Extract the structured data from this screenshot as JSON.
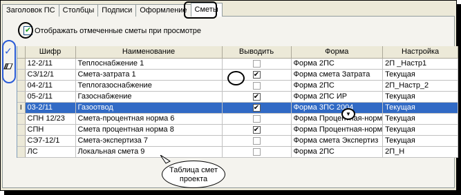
{
  "tabs": [
    {
      "label": "Заголовок ПС"
    },
    {
      "label": "Столбцы"
    },
    {
      "label": "Подписи"
    },
    {
      "label": "Оформление"
    },
    {
      "label": "Сметы"
    }
  ],
  "show_checkbox": {
    "label": "Отображать отмеченные сметы при просмотре",
    "checked": true
  },
  "grid": {
    "headers": [
      "Шифр",
      "Наименование",
      "Выводить",
      "Форма",
      "Настройка"
    ],
    "current_row_marker": "I",
    "rows": [
      {
        "code": "12-2/11",
        "name": "Теплоснабжение 1",
        "output": false,
        "form": "Форма 2ПС",
        "setting": "2П _Настр1"
      },
      {
        "code": "С3/12/1",
        "name": "Смета-затрата 1",
        "output": true,
        "form": "Форма смета Затрата",
        "setting": "Текущая"
      },
      {
        "code": "04-2/11",
        "name": "Теплогазоснабжение",
        "output": false,
        "form": "Форма 2ПС",
        "setting": "2П_Настр_2"
      },
      {
        "code": "05-2/11",
        "name": "Газоснабжение",
        "output": true,
        "form": "Форма 2ПС ИР",
        "setting": "Текущая"
      },
      {
        "code": "03-2/11",
        "name": "Газоотвод",
        "output": true,
        "form": "Форма 3ПС 2004",
        "setting": "Текущая",
        "selected": true
      },
      {
        "code": "СПН 12/23",
        "name": "Смета-процентная норма 6",
        "output": false,
        "form": "Форма Процентная-норм",
        "setting": "Текущая"
      },
      {
        "code": "СПН",
        "name": "Смета процентная норма 8",
        "output": true,
        "form": "Форма Процентная-норм",
        "setting": "Текущая"
      },
      {
        "code": "СЭ7-12/1",
        "name": "Смета-экспертиза 7",
        "output": false,
        "form": "Форма смета Экспертиз",
        "setting": "Текущая"
      },
      {
        "code": "ЛС",
        "name": "Локальная смета 9",
        "output": false,
        "form": "Форма 2ПС",
        "setting": "2П_Н"
      }
    ]
  },
  "callout": {
    "line1": "Таблица смет",
    "line2": "проекта"
  },
  "colors": {
    "selection": "#316ac5",
    "accent_ring": "#2a5bd7"
  },
  "icons": [
    "check-icon",
    "eraser-icon",
    "dropdown-arrow-icon"
  ]
}
